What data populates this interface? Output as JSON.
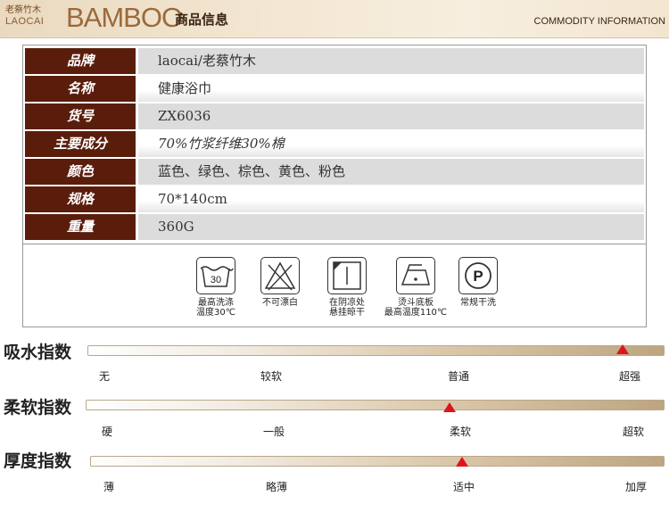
{
  "header": {
    "logo_cn_small": "老蔡竹木",
    "logo_en_small": "LAOCAI",
    "logo_big": "BAMBOO",
    "title_cn": "商品信息",
    "title_en": "COMMODITY INFORMATION"
  },
  "info_rows": [
    {
      "label": "品牌",
      "value": "laocai/老蔡竹木"
    },
    {
      "label": "名称",
      "value": "健康浴巾"
    },
    {
      "label": "货号",
      "value": "ZX6036"
    },
    {
      "label": "主要成分",
      "value": "70%竹浆纤维30%棉"
    },
    {
      "label": "颜色",
      "value": "蓝色、绿色、棕色、黄色、粉色"
    },
    {
      "label": "规格",
      "value": "70*140cm"
    },
    {
      "label": "重量",
      "value": "360G"
    }
  ],
  "care": [
    {
      "icon": "wash-30-icon",
      "temp": "30",
      "caption1": "最高洗涤",
      "caption2": "温度30℃"
    },
    {
      "icon": "no-bleach-icon",
      "caption1": "不可漂白",
      "caption2": ""
    },
    {
      "icon": "shade-drip-dry-icon",
      "caption1": "在阴凉处",
      "caption2": "悬挂晾干"
    },
    {
      "icon": "iron-110-icon",
      "caption1": "烫斗底板",
      "caption2": "最高温度110℃"
    },
    {
      "icon": "dry-clean-p-icon",
      "letter": "P",
      "caption1": "常规干洗",
      "caption2": ""
    }
  ],
  "indices": [
    {
      "title": "吸水指数",
      "ticks": [
        "无",
        "较软",
        "普通",
        "超强"
      ],
      "level": 0.93
    },
    {
      "title": "柔软指数",
      "ticks": [
        "硬",
        "一般",
        "柔软",
        "超软"
      ],
      "level": 0.63
    },
    {
      "title": "厚度指数",
      "ticks": [
        "薄",
        "略薄",
        "适中",
        "加厚"
      ],
      "level": 0.65
    }
  ],
  "colors": {
    "label_bg": "#5a1d0c",
    "marker": "#e0141b"
  }
}
